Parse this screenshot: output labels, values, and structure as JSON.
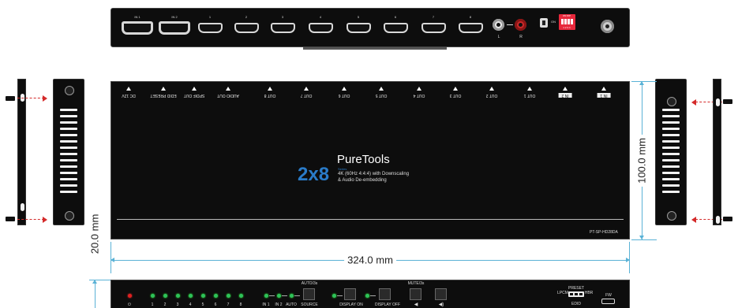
{
  "rear_panel": {
    "hdmi_inputs": [
      "IN 1",
      "IN 2"
    ],
    "hdmi_outputs": [
      "1",
      "2",
      "3",
      "4",
      "5",
      "6",
      "7",
      "8"
    ],
    "audio_l": "L",
    "audio_r": "R",
    "dip_on": "ON DIP",
    "dip_nums": "1 2 3 4"
  },
  "top_view": {
    "port_labels": [
      "DC 12V",
      "EDID PRESET",
      "SPDIF OUT",
      "AUDIO OUT",
      "OUT 8",
      "OUT 7",
      "OUT 6",
      "OUT 5",
      "OUT 4",
      "OUT 3",
      "OUT 2",
      "OUT 1",
      "IN 2",
      "IN 1"
    ],
    "brand": "PureTools",
    "model_big": "2x8",
    "series": "Series",
    "desc_line1": "4K (60Hz 4:4:4) with Downscaling",
    "desc_line2": "& Audio De-embedding",
    "model_code": "PT-SP-HD28DA"
  },
  "dimensions": {
    "width": "324.0 mm",
    "depth": "100.0 mm",
    "height": "20.0 mm"
  },
  "front_panel": {
    "output_leds": [
      "1",
      "2",
      "3",
      "4",
      "5",
      "6",
      "7",
      "8"
    ],
    "input_labels": [
      "IN 1",
      "IN 2",
      "AUTO",
      "SOURCE"
    ],
    "auto_label": "AUTO/3s",
    "display_on": "DISPLAY ON",
    "display_off": "DISPLAY OFF",
    "mute_label": "MUTE/3s",
    "preset_label": "PRESET",
    "lpcm": "LPCM",
    "hbr": "HBR",
    "edid": "EDID",
    "fw": "FW"
  },
  "colors": {
    "device": "#0d0d0d",
    "accent_blue": "#2a7bc8",
    "dimension_line": "#5ab2d6",
    "arrow_red": "#d42a2a",
    "dip_red": "#e8283c"
  }
}
